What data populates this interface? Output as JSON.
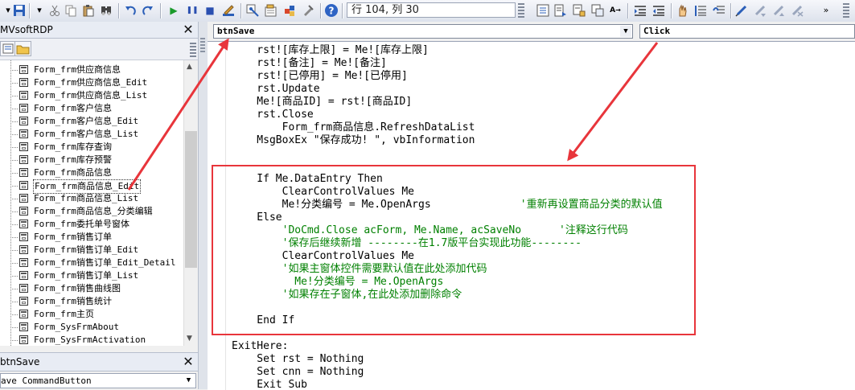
{
  "toolbar": {
    "cursor_position": "行 104, 列 30",
    "buttons": [
      {
        "name": "run",
        "icon": "run-icon",
        "glyph": "▶",
        "color": "#1a9a2a"
      },
      {
        "name": "break",
        "icon": "pause-icon",
        "glyph": "❚❚",
        "color": "#2a4fb0"
      },
      {
        "name": "reset",
        "icon": "stop-icon",
        "glyph": "■",
        "color": "#2a4fb0"
      },
      {
        "name": "help",
        "icon": "help-icon",
        "glyph": "?",
        "color": "#ffffff"
      }
    ]
  },
  "project": {
    "title": "MVsoftRDP",
    "items": [
      {
        "label": "Form_frm供应商信息"
      },
      {
        "label": "Form_frm供应商信息_Edit"
      },
      {
        "label": "Form_frm供应商信息_List"
      },
      {
        "label": "Form_frm客户信息"
      },
      {
        "label": "Form_frm客户信息_Edit"
      },
      {
        "label": "Form_frm客户信息_List"
      },
      {
        "label": "Form_frm库存查询"
      },
      {
        "label": "Form_frm库存预警"
      },
      {
        "label": "Form_frm商品信息"
      },
      {
        "label": "Form_frm商品信息_Edit",
        "selected": true
      },
      {
        "label": "Form_frm商品信息_List"
      },
      {
        "label": "Form_frm商品信息_分类编辑"
      },
      {
        "label": "Form_frm委托单号窗体"
      },
      {
        "label": "Form_frm销售订单"
      },
      {
        "label": "Form_frm销售订单_Edit"
      },
      {
        "label": "Form_frm销售订单_Edit_Detail"
      },
      {
        "label": "Form_frm销售订单_List"
      },
      {
        "label": "Form_frm销售曲线图"
      },
      {
        "label": "Form_frm销售统计"
      },
      {
        "label": "Form_frm主页"
      },
      {
        "label": "Form_SysFrmAbout"
      },
      {
        "label": "Form_SysFrmActivation"
      }
    ]
  },
  "properties": {
    "title": "btnSave",
    "object_type": "ave CommandButton"
  },
  "code": {
    "object_combo": "btnSave",
    "procedure_combo": "Click",
    "lines": [
      {
        "text": "    rst![库存上限] = Me![库存上限]",
        "comment": false
      },
      {
        "text": "    rst![备注] = Me![备注]",
        "comment": false
      },
      {
        "text": "    rst![已停用] = Me![已停用]",
        "comment": false
      },
      {
        "text": "    rst.Update",
        "comment": false
      },
      {
        "text": "    Me![商品ID] = rst![商品ID]",
        "comment": false
      },
      {
        "text": "    rst.Close",
        "comment": false
      },
      {
        "text": "        Form_frm商品信息.RefreshDataList",
        "comment": false
      },
      {
        "text": "    MsgBoxEx \"保存成功! \", vbInformation",
        "comment": false
      },
      {
        "text": "",
        "comment": false
      },
      {
        "text": "",
        "comment": false
      },
      {
        "text": "    If Me.DataEntry Then",
        "comment": false
      },
      {
        "text": "        ClearControlValues Me",
        "comment": false
      },
      {
        "text": "        Me!分类编号 = Me.OpenArgs",
        "comment": false
      },
      {
        "text": "    Else",
        "comment": false
      },
      {
        "text": "",
        "comment": false
      },
      {
        "text": "",
        "comment": false
      },
      {
        "text": "        ClearControlValues Me",
        "comment": false
      },
      {
        "text": "",
        "comment": false
      },
      {
        "text": "",
        "comment": false
      },
      {
        "text": "",
        "comment": false
      },
      {
        "text": "",
        "comment": false
      },
      {
        "text": "    End If",
        "comment": false
      },
      {
        "text": "",
        "comment": false
      },
      {
        "text": "ExitHere:",
        "comment": false
      },
      {
        "text": "    Set rst = Nothing",
        "comment": false
      },
      {
        "text": "    Set cnn = Nothing",
        "comment": false
      },
      {
        "text": "    Exit Sub",
        "comment": false
      }
    ],
    "comments": [
      {
        "line": 12,
        "text": "'重新再设置商品分类的默认值",
        "indent": 46
      },
      {
        "line": 14,
        "text": "        'DoCmd.Close acForm, Me.Name, acSaveNo      '注释这行代码",
        "indent": 0
      },
      {
        "line": 15,
        "text": "        '保存后继续新增 --------在1.7版平台实现此功能--------",
        "indent": 0
      },
      {
        "line": 17,
        "text": "        '如果主窗体控件需要默认值在此处添加代码",
        "indent": 0
      },
      {
        "line": 18,
        "text": "          Me!分类编号 = Me.OpenArgs",
        "indent": 0
      },
      {
        "line": 19,
        "text": "        '如果存在子窗体,在此处添加删除命令",
        "indent": 0
      }
    ]
  },
  "annotation": {
    "color": "#e8353b"
  }
}
